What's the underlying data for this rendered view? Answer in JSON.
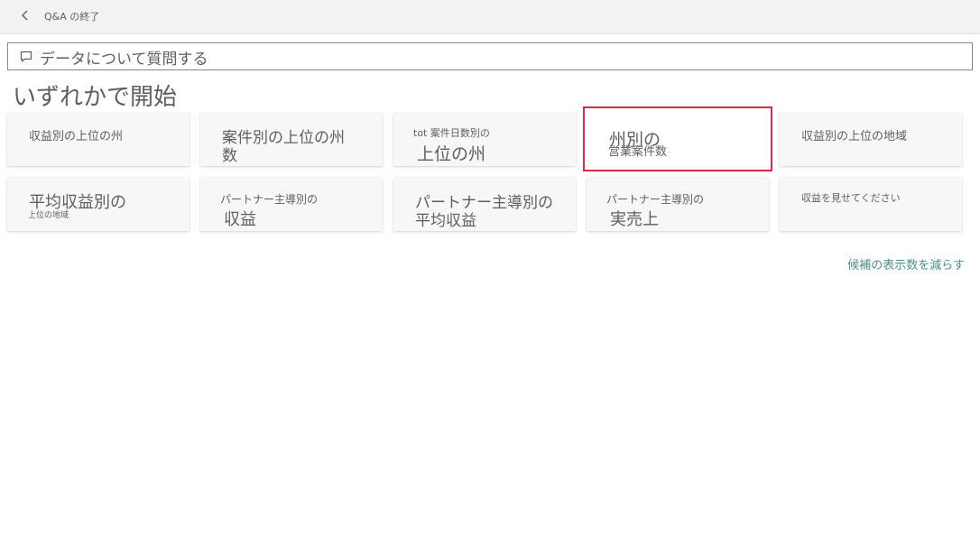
{
  "header": {
    "back_label": "Q&A の終了"
  },
  "search": {
    "placeholder": "データについて質問する"
  },
  "heading": "いずれかで開始",
  "cards": [
    {
      "line1": "収益別の上位の州",
      "line2": ""
    },
    {
      "line1": "案件別の上位の州",
      "line2": "数"
    },
    {
      "line1": "tot 案件日数別の",
      "line2": "上位の州"
    },
    {
      "line1": "州別の",
      "line2": "営業案件数"
    },
    {
      "line1": "収益別の上位の地域",
      "line2": ""
    },
    {
      "line1": "平均収益別の",
      "line2": "上位の地域"
    },
    {
      "line1": "パートナー主導別の",
      "line2": "収益"
    },
    {
      "line1": "パートナー主導別の",
      "line2": "平均収益"
    },
    {
      "line1": "パートナー主導別の",
      "line2": "実売上"
    },
    {
      "line1": "収益を見せてください",
      "line2": ""
    }
  ],
  "show_fewer_label": "候補の表示数を減らす",
  "colors": {
    "selected_outline": "#d62b45",
    "link": "#4f8f8b",
    "text": "#605e5c"
  }
}
